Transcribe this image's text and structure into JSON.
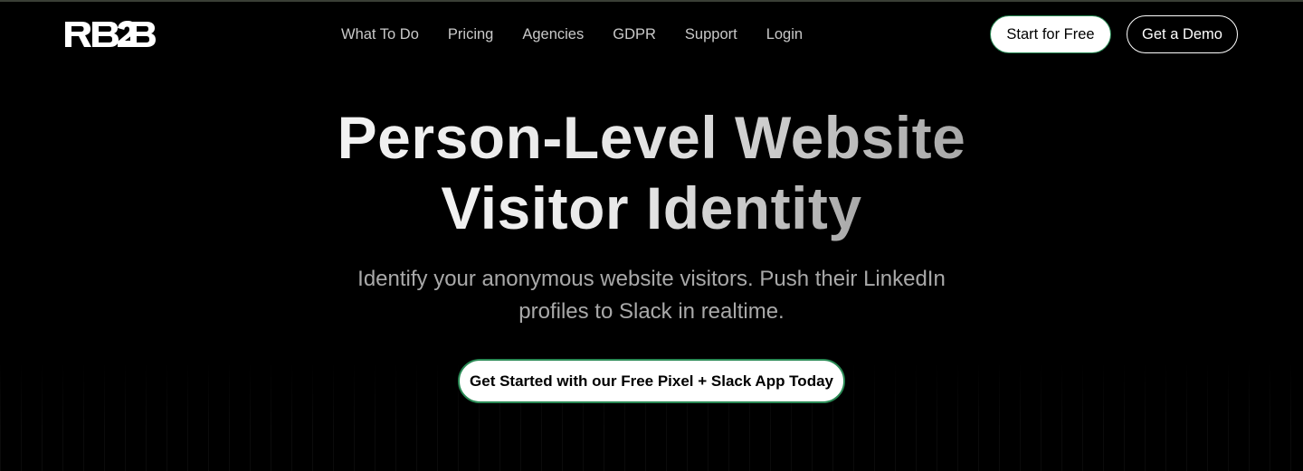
{
  "header": {
    "logo_text": "RB2B",
    "nav": [
      {
        "label": "What To Do"
      },
      {
        "label": "Pricing"
      },
      {
        "label": "Agencies"
      },
      {
        "label": "GDPR"
      },
      {
        "label": "Support"
      },
      {
        "label": "Login"
      }
    ],
    "start_free_label": "Start for Free",
    "demo_label": "Get a Demo"
  },
  "hero": {
    "title_line1": "Person-Level Website",
    "title_line2": "Visitor Identity",
    "subtitle": "Identify your anonymous website visitors. Push their LinkedIn profiles to Slack in realtime.",
    "cta_label": "Get Started with our Free Pixel + Slack App Today"
  },
  "colors": {
    "background": "#000000",
    "accent_border": "#2a8a55",
    "text_primary": "#ffffff",
    "text_muted": "#a9a9a9"
  }
}
